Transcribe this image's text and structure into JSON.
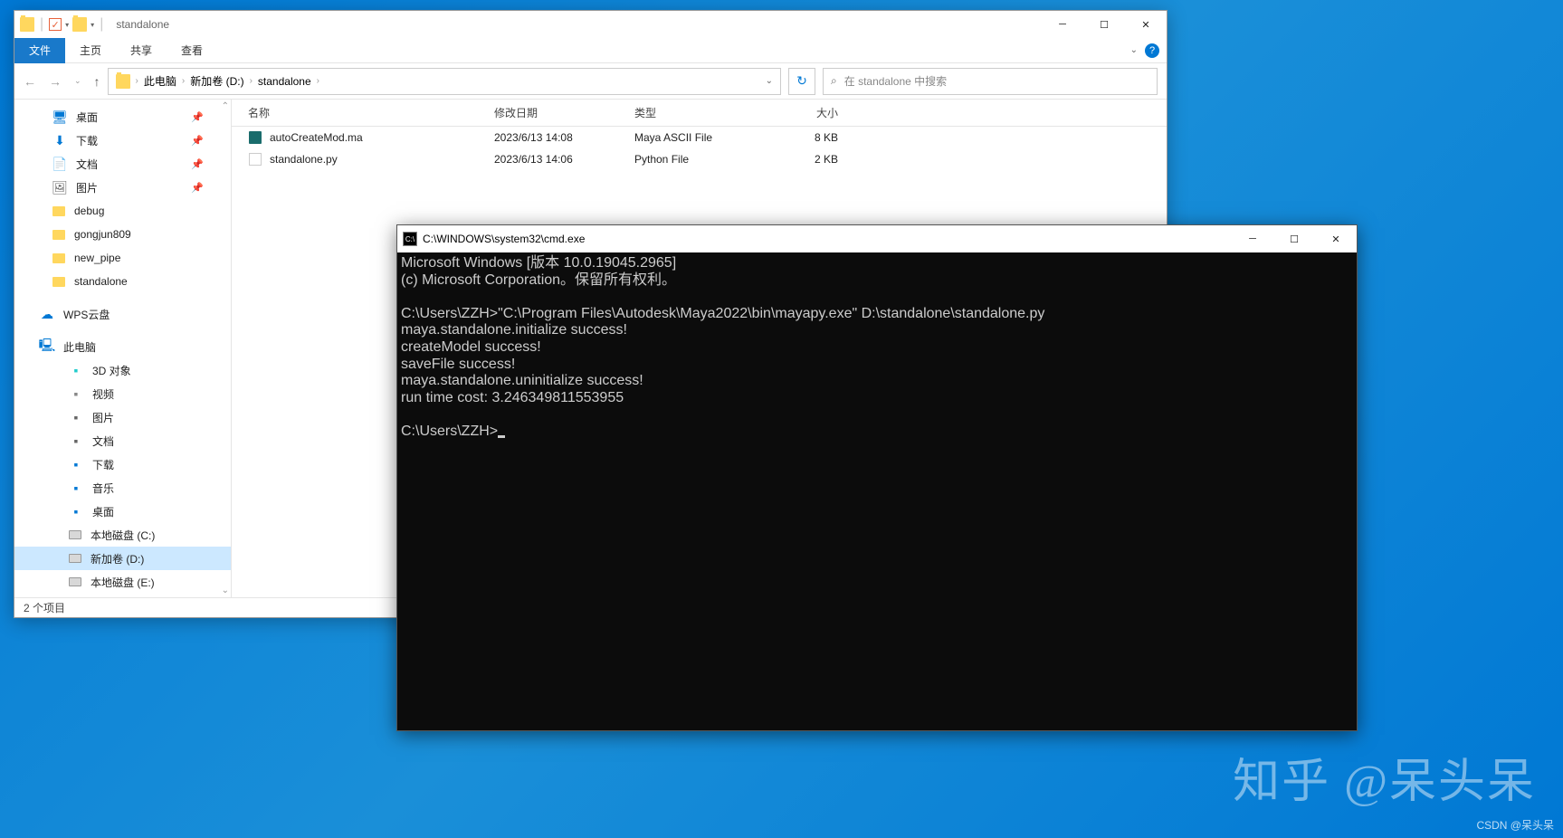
{
  "explorer": {
    "title": "standalone",
    "ribbon": {
      "file": "文件",
      "home": "主页",
      "share": "共享",
      "view": "查看"
    },
    "nav": {
      "back": "←",
      "forward": "→",
      "up": "↑"
    },
    "breadcrumb": {
      "root": "此电脑",
      "drive": "新加卷 (D:)",
      "folder": "standalone"
    },
    "refresh": "↻",
    "search": {
      "placeholder": "在 standalone 中搜索"
    },
    "columns": {
      "name": "名称",
      "date": "修改日期",
      "type": "类型",
      "size": "大小"
    },
    "files": [
      {
        "name": "autoCreateMod.ma",
        "date": "2023/6/13 14:08",
        "type": "Maya ASCII File",
        "size": "8 KB",
        "icon": "maya"
      },
      {
        "name": "standalone.py",
        "date": "2023/6/13 14:06",
        "type": "Python File",
        "size": "2 KB",
        "icon": "py"
      }
    ],
    "sidebar": {
      "quick": [
        {
          "label": "桌面",
          "icon": "🖥",
          "color": "#0078d4",
          "pin": true
        },
        {
          "label": "下载",
          "icon": "⬇",
          "color": "#0078d4",
          "pin": true
        },
        {
          "label": "文档",
          "icon": "📄",
          "color": "#666",
          "pin": true
        },
        {
          "label": "图片",
          "icon": "🖼",
          "color": "#666",
          "pin": true
        },
        {
          "label": "debug",
          "icon": "folder"
        },
        {
          "label": "gongjun809",
          "icon": "folder"
        },
        {
          "label": "new_pipe",
          "icon": "folder"
        },
        {
          "label": "standalone",
          "icon": "folder"
        }
      ],
      "wps": "WPS云盘",
      "thispc": "此电脑",
      "pc_items": [
        {
          "label": "3D 对象",
          "color": "#2cc"
        },
        {
          "label": "视频",
          "color": "#888"
        },
        {
          "label": "图片",
          "color": "#666"
        },
        {
          "label": "文档",
          "color": "#666"
        },
        {
          "label": "下载",
          "color": "#0078d4"
        },
        {
          "label": "音乐",
          "color": "#0078d4"
        },
        {
          "label": "桌面",
          "color": "#0078d4"
        },
        {
          "label": "本地磁盘 (C:)",
          "drive": true
        },
        {
          "label": "新加卷 (D:)",
          "drive": true,
          "selected": true
        },
        {
          "label": "本地磁盘 (E:)",
          "drive": true
        }
      ]
    },
    "status": "2 个项目"
  },
  "cmd": {
    "title": "C:\\WINDOWS\\system32\\cmd.exe",
    "lines": "Microsoft Windows [版本 10.0.19045.2965]\n(c) Microsoft Corporation。保留所有权利。\n\nC:\\Users\\ZZH>\"C:\\Program Files\\Autodesk\\Maya2022\\bin\\mayapy.exe\" D:\\standalone\\standalone.py\nmaya.standalone.initialize success!\ncreateModel success!\nsaveFile success!\nmaya.standalone.uninitialize success!\nrun time cost: 3.246349811553955\n\nC:\\Users\\ZZH>"
  },
  "watermark": {
    "main": "知乎 @呆头呆",
    "sub": "CSDN @呆头呆"
  }
}
